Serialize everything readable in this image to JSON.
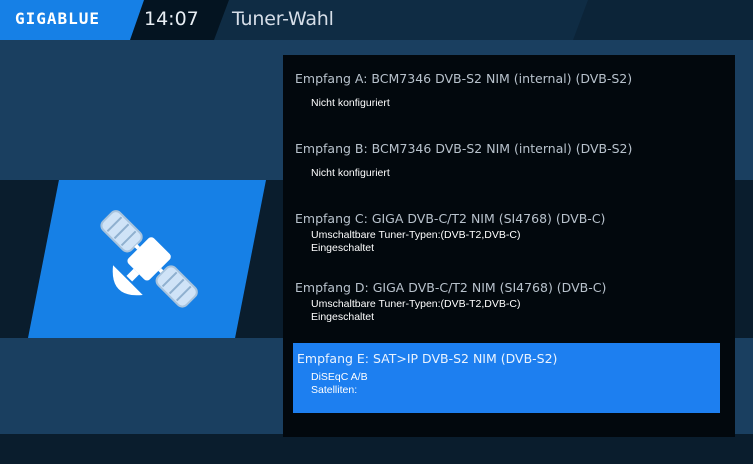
{
  "header": {
    "logo": "GIGABLUE",
    "time": "14:07",
    "title": "Tuner-Wahl"
  },
  "tuners": [
    {
      "title": "Empfang A: BCM7346 DVB-S2 NIM (internal) (DVB-S2)",
      "lines": [
        "Nicht konfiguriert"
      ]
    },
    {
      "title": "Empfang B: BCM7346 DVB-S2 NIM (internal) (DVB-S2)",
      "lines": [
        "Nicht konfiguriert"
      ]
    },
    {
      "title": "Empfang C: GIGA DVB-C/T2 NIM (SI4768) (DVB-C)",
      "lines": [
        "Umschaltbare Tuner-Typen:(DVB-T2,DVB-C)",
        "Eingeschaltet"
      ]
    },
    {
      "title": "Empfang D: GIGA DVB-C/T2 NIM (SI4768) (DVB-C)",
      "lines": [
        "Umschaltbare Tuner-Typen:(DVB-T2,DVB-C)",
        "Eingeschaltet"
      ]
    },
    {
      "title": "Empfang E: SAT>IP DVB-S2 NIM (DVB-S2)",
      "lines": [
        "DiSEqC A/B",
        "Satelliten:"
      ],
      "selected": true
    }
  ],
  "colors": {
    "accent": "#1680e6",
    "background": "#1a3f60",
    "selection": "#1d7ff0"
  }
}
